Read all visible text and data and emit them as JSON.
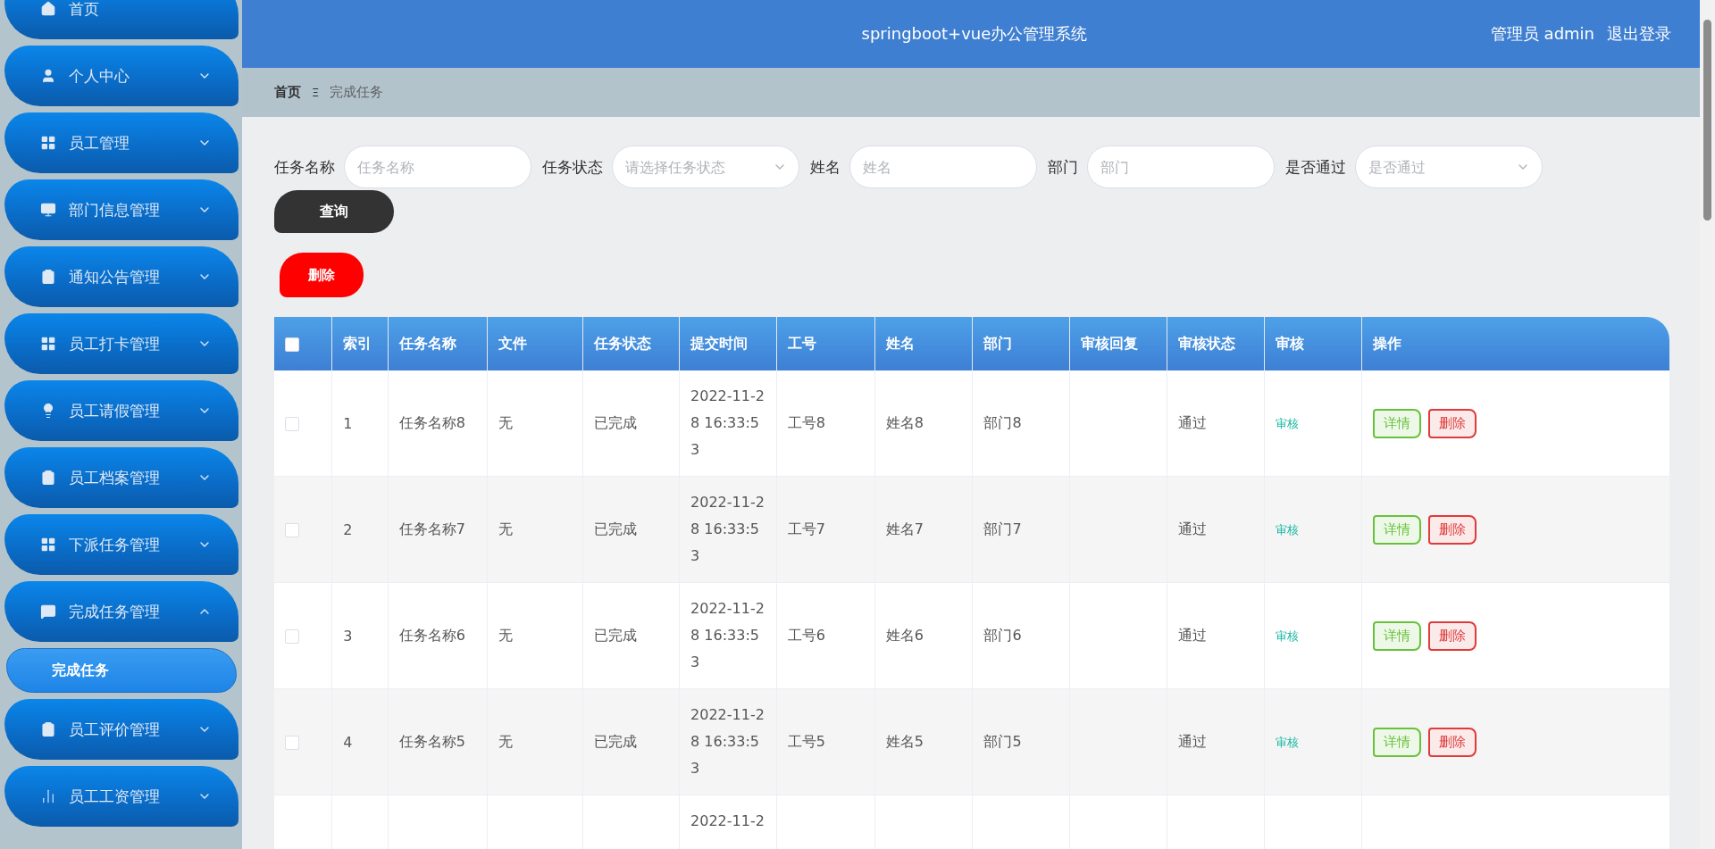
{
  "sidebar": {
    "items": [
      {
        "label": "首页",
        "kind": "link"
      },
      {
        "label": "个人中心",
        "kind": "menu",
        "expanded": false
      },
      {
        "label": "员工管理",
        "kind": "menu",
        "expanded": false
      },
      {
        "label": "部门信息管理",
        "kind": "menu",
        "expanded": false
      },
      {
        "label": "通知公告管理",
        "kind": "menu",
        "expanded": false
      },
      {
        "label": "员工打卡管理",
        "kind": "menu",
        "expanded": false
      },
      {
        "label": "员工请假管理",
        "kind": "menu",
        "expanded": false
      },
      {
        "label": "员工档案管理",
        "kind": "menu",
        "expanded": false
      },
      {
        "label": "下派任务管理",
        "kind": "menu",
        "expanded": false
      },
      {
        "label": "完成任务管理",
        "kind": "menu",
        "expanded": true,
        "children": [
          {
            "label": "完成任务",
            "selected": true
          }
        ]
      },
      {
        "label": "员工评价管理",
        "kind": "menu",
        "expanded": false
      },
      {
        "label": "员工工资管理",
        "kind": "menu",
        "expanded": false
      }
    ]
  },
  "header": {
    "title": "springboot+vue办公管理系统",
    "user": "管理员 admin",
    "logout": "退出登录"
  },
  "breadcrumb": {
    "home": "首页",
    "separator": "Ξ",
    "current": "完成任务"
  },
  "search": {
    "fields": [
      {
        "label": "任务名称",
        "kind": "input",
        "placeholder": "任务名称"
      },
      {
        "label": "任务状态",
        "kind": "select",
        "placeholder": "请选择任务状态"
      },
      {
        "label": "姓名",
        "kind": "input",
        "placeholder": "姓名"
      },
      {
        "label": "部门",
        "kind": "input",
        "placeholder": "部门"
      },
      {
        "label": "是否通过",
        "kind": "select",
        "placeholder": "是否通过"
      }
    ],
    "query_button": "查询"
  },
  "delete_button": "删除",
  "table": {
    "select_all_checked": false,
    "columns": [
      "索引",
      "任务名称",
      "文件",
      "任务状态",
      "提交时间",
      "工号",
      "姓名",
      "部门",
      "审核回复",
      "审核状态",
      "审核",
      "操作"
    ],
    "rows": [
      {
        "checked": false,
        "index": "1",
        "task": "任务名称8",
        "file": "无",
        "status": "已完成",
        "time": "2022-11-28 16:33:53",
        "emp_no": "工号8",
        "name": "姓名8",
        "dept": "部门8",
        "reply": "",
        "review_status": "通过",
        "review": "审核",
        "actions": [
          "详情",
          "删除"
        ]
      },
      {
        "checked": false,
        "index": "2",
        "task": "任务名称7",
        "file": "无",
        "status": "已完成",
        "time": "2022-11-28 16:33:53",
        "emp_no": "工号7",
        "name": "姓名7",
        "dept": "部门7",
        "reply": "",
        "review_status": "通过",
        "review": "审核",
        "actions": [
          "详情",
          "删除"
        ]
      },
      {
        "checked": false,
        "index": "3",
        "task": "任务名称6",
        "file": "无",
        "status": "已完成",
        "time": "2022-11-28 16:33:53",
        "emp_no": "工号6",
        "name": "姓名6",
        "dept": "部门6",
        "reply": "",
        "review_status": "通过",
        "review": "审核",
        "actions": [
          "详情",
          "删除"
        ]
      },
      {
        "checked": false,
        "index": "4",
        "task": "任务名称5",
        "file": "无",
        "status": "已完成",
        "time": "2022-11-28 16:33:53",
        "emp_no": "工号5",
        "name": "姓名5",
        "dept": "部门5",
        "reply": "",
        "review_status": "通过",
        "review": "审核",
        "actions": [
          "详情",
          "删除"
        ]
      },
      {
        "time": "2022-11-2"
      }
    ]
  }
}
